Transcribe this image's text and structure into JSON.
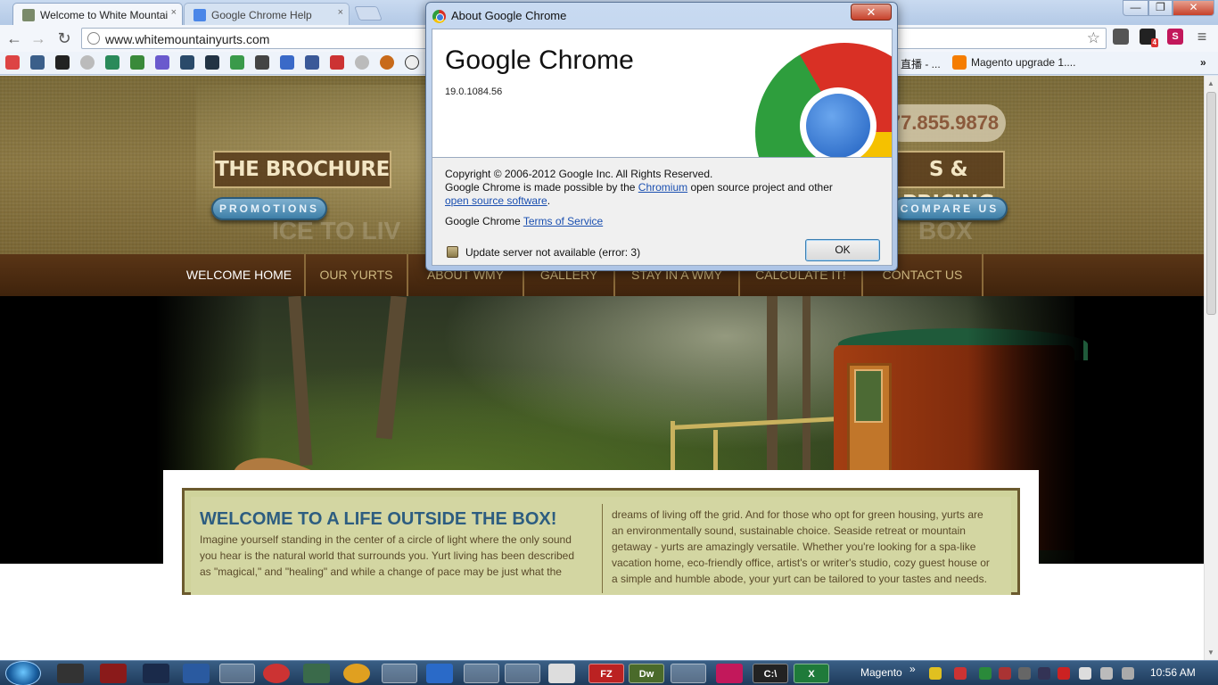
{
  "browser": {
    "tabs": [
      {
        "label": "Welcome to White Mountai",
        "close": "×"
      },
      {
        "label": "Google Chrome Help",
        "close": "×"
      }
    ],
    "window_buttons": {
      "minimize": "—",
      "maximize": "❐",
      "close": "✕"
    },
    "nav": {
      "back": "←",
      "forward": "→",
      "reload": "↻"
    },
    "url": "www.whitemountainyurts.com",
    "star": "☆",
    "menu": "≡",
    "extension_badge": "4"
  },
  "bookmarks": [
    {
      "label": "直播 - ..."
    },
    {
      "label": "Magento upgrade 1...."
    }
  ],
  "bookmarks_overflow": "»",
  "site": {
    "brochure_label": "THE BROCHURE",
    "promotions_label": "PROMOTIONS",
    "phone": "77.855.9878",
    "pricing_label": "S & PRICING",
    "compare_label": "COMPARE US",
    "ghost_left": "ICE TO LIV",
    "ghost_right": "BOX",
    "nav": [
      {
        "label": "WELCOME HOME"
      },
      {
        "label": "OUR YURTS"
      },
      {
        "label": "ABOUT WMY"
      },
      {
        "label": "GALLERY"
      },
      {
        "label": "STAY IN A WMY"
      },
      {
        "label": "CALCULATE IT!"
      },
      {
        "label": "CONTACT US"
      }
    ],
    "welcome_title": "WELCOME TO A LIFE OUTSIDE THE BOX!",
    "left_text": [
      "Imagine yourself standing in the center of a circle of light where the only sound",
      "you hear is the natural world that surrounds you. Yurt living has been described",
      "as \"magical,\" and \"healing\" and while a change of pace may be just what the"
    ],
    "right_text": [
      "dreams of living off the grid. And for those who opt for green housing, yurts are",
      "an environmentally sound, sustainable choice. Seaside retreat or mountain",
      "getaway - yurts are amazingly versatile. Whether you're looking for a spa-like",
      "vacation home, eco-friendly office, artist's or writer's studio, cozy guest house or",
      "a simple and humble abode, your yurt can be tailored to your tastes and needs."
    ]
  },
  "dialog": {
    "title": "About Google Chrome",
    "close": "✕",
    "product": "Google Chrome",
    "version": "19.0.1084.56",
    "copyright": "Copyright © 2006-2012 Google Inc. All Rights Reserved.",
    "made_possible_prefix": "Google Chrome is made possible by the ",
    "chromium_link": "Chromium",
    "made_possible_suffix": " open source project and other",
    "oss_link": "open source software",
    "oss_suffix": ".",
    "tos_prefix": "Google Chrome ",
    "tos_link": "Terms of Service",
    "update_status": "Update server not available (error: 3)",
    "ok_label": "OK"
  },
  "taskbar": {
    "tray_label": "Magento",
    "tray_overflow": "»",
    "clock": "10:56 AM",
    "app_labels": {
      "filezilla": "FZ",
      "dreamweaver": "Dw",
      "terminal": "C:\\",
      "excel": "X"
    }
  },
  "colors": {
    "nav_bg": "#4a2a10",
    "nav_text": "#cdb77f",
    "welcome_title": "#2d5d80",
    "content_bg": "#d3d6a2",
    "dialog_link": "#1a4fb0"
  }
}
